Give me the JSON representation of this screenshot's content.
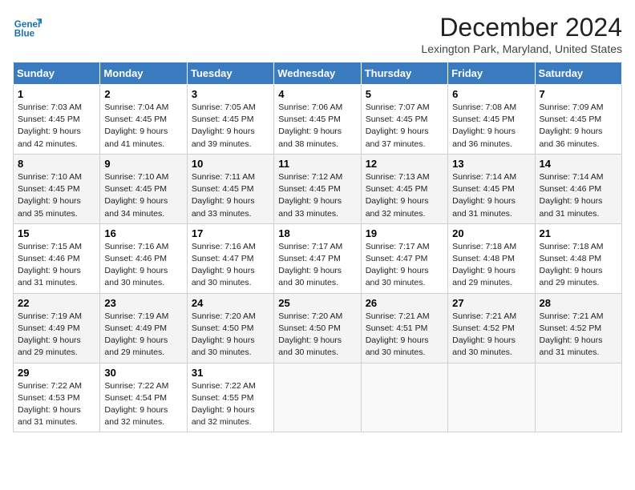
{
  "header": {
    "logo_text_general": "General",
    "logo_text_blue": "Blue",
    "month_title": "December 2024",
    "location": "Lexington Park, Maryland, United States"
  },
  "calendar": {
    "days_of_week": [
      "Sunday",
      "Monday",
      "Tuesday",
      "Wednesday",
      "Thursday",
      "Friday",
      "Saturday"
    ],
    "weeks": [
      [
        {
          "day": "1",
          "sunrise": "7:03 AM",
          "sunset": "4:45 PM",
          "daylight": "9 hours and 42 minutes."
        },
        {
          "day": "2",
          "sunrise": "7:04 AM",
          "sunset": "4:45 PM",
          "daylight": "9 hours and 41 minutes."
        },
        {
          "day": "3",
          "sunrise": "7:05 AM",
          "sunset": "4:45 PM",
          "daylight": "9 hours and 39 minutes."
        },
        {
          "day": "4",
          "sunrise": "7:06 AM",
          "sunset": "4:45 PM",
          "daylight": "9 hours and 38 minutes."
        },
        {
          "day": "5",
          "sunrise": "7:07 AM",
          "sunset": "4:45 PM",
          "daylight": "9 hours and 37 minutes."
        },
        {
          "day": "6",
          "sunrise": "7:08 AM",
          "sunset": "4:45 PM",
          "daylight": "9 hours and 36 minutes."
        },
        {
          "day": "7",
          "sunrise": "7:09 AM",
          "sunset": "4:45 PM",
          "daylight": "9 hours and 36 minutes."
        }
      ],
      [
        {
          "day": "8",
          "sunrise": "7:10 AM",
          "sunset": "4:45 PM",
          "daylight": "9 hours and 35 minutes."
        },
        {
          "day": "9",
          "sunrise": "7:10 AM",
          "sunset": "4:45 PM",
          "daylight": "9 hours and 34 minutes."
        },
        {
          "day": "10",
          "sunrise": "7:11 AM",
          "sunset": "4:45 PM",
          "daylight": "9 hours and 33 minutes."
        },
        {
          "day": "11",
          "sunrise": "7:12 AM",
          "sunset": "4:45 PM",
          "daylight": "9 hours and 33 minutes."
        },
        {
          "day": "12",
          "sunrise": "7:13 AM",
          "sunset": "4:45 PM",
          "daylight": "9 hours and 32 minutes."
        },
        {
          "day": "13",
          "sunrise": "7:14 AM",
          "sunset": "4:45 PM",
          "daylight": "9 hours and 31 minutes."
        },
        {
          "day": "14",
          "sunrise": "7:14 AM",
          "sunset": "4:46 PM",
          "daylight": "9 hours and 31 minutes."
        }
      ],
      [
        {
          "day": "15",
          "sunrise": "7:15 AM",
          "sunset": "4:46 PM",
          "daylight": "9 hours and 31 minutes."
        },
        {
          "day": "16",
          "sunrise": "7:16 AM",
          "sunset": "4:46 PM",
          "daylight": "9 hours and 30 minutes."
        },
        {
          "day": "17",
          "sunrise": "7:16 AM",
          "sunset": "4:47 PM",
          "daylight": "9 hours and 30 minutes."
        },
        {
          "day": "18",
          "sunrise": "7:17 AM",
          "sunset": "4:47 PM",
          "daylight": "9 hours and 30 minutes."
        },
        {
          "day": "19",
          "sunrise": "7:17 AM",
          "sunset": "4:47 PM",
          "daylight": "9 hours and 30 minutes."
        },
        {
          "day": "20",
          "sunrise": "7:18 AM",
          "sunset": "4:48 PM",
          "daylight": "9 hours and 29 minutes."
        },
        {
          "day": "21",
          "sunrise": "7:18 AM",
          "sunset": "4:48 PM",
          "daylight": "9 hours and 29 minutes."
        }
      ],
      [
        {
          "day": "22",
          "sunrise": "7:19 AM",
          "sunset": "4:49 PM",
          "daylight": "9 hours and 29 minutes."
        },
        {
          "day": "23",
          "sunrise": "7:19 AM",
          "sunset": "4:49 PM",
          "daylight": "9 hours and 29 minutes."
        },
        {
          "day": "24",
          "sunrise": "7:20 AM",
          "sunset": "4:50 PM",
          "daylight": "9 hours and 30 minutes."
        },
        {
          "day": "25",
          "sunrise": "7:20 AM",
          "sunset": "4:50 PM",
          "daylight": "9 hours and 30 minutes."
        },
        {
          "day": "26",
          "sunrise": "7:21 AM",
          "sunset": "4:51 PM",
          "daylight": "9 hours and 30 minutes."
        },
        {
          "day": "27",
          "sunrise": "7:21 AM",
          "sunset": "4:52 PM",
          "daylight": "9 hours and 30 minutes."
        },
        {
          "day": "28",
          "sunrise": "7:21 AM",
          "sunset": "4:52 PM",
          "daylight": "9 hours and 31 minutes."
        }
      ],
      [
        {
          "day": "29",
          "sunrise": "7:22 AM",
          "sunset": "4:53 PM",
          "daylight": "9 hours and 31 minutes."
        },
        {
          "day": "30",
          "sunrise": "7:22 AM",
          "sunset": "4:54 PM",
          "daylight": "9 hours and 32 minutes."
        },
        {
          "day": "31",
          "sunrise": "7:22 AM",
          "sunset": "4:55 PM",
          "daylight": "9 hours and 32 minutes."
        },
        null,
        null,
        null,
        null
      ]
    ]
  }
}
